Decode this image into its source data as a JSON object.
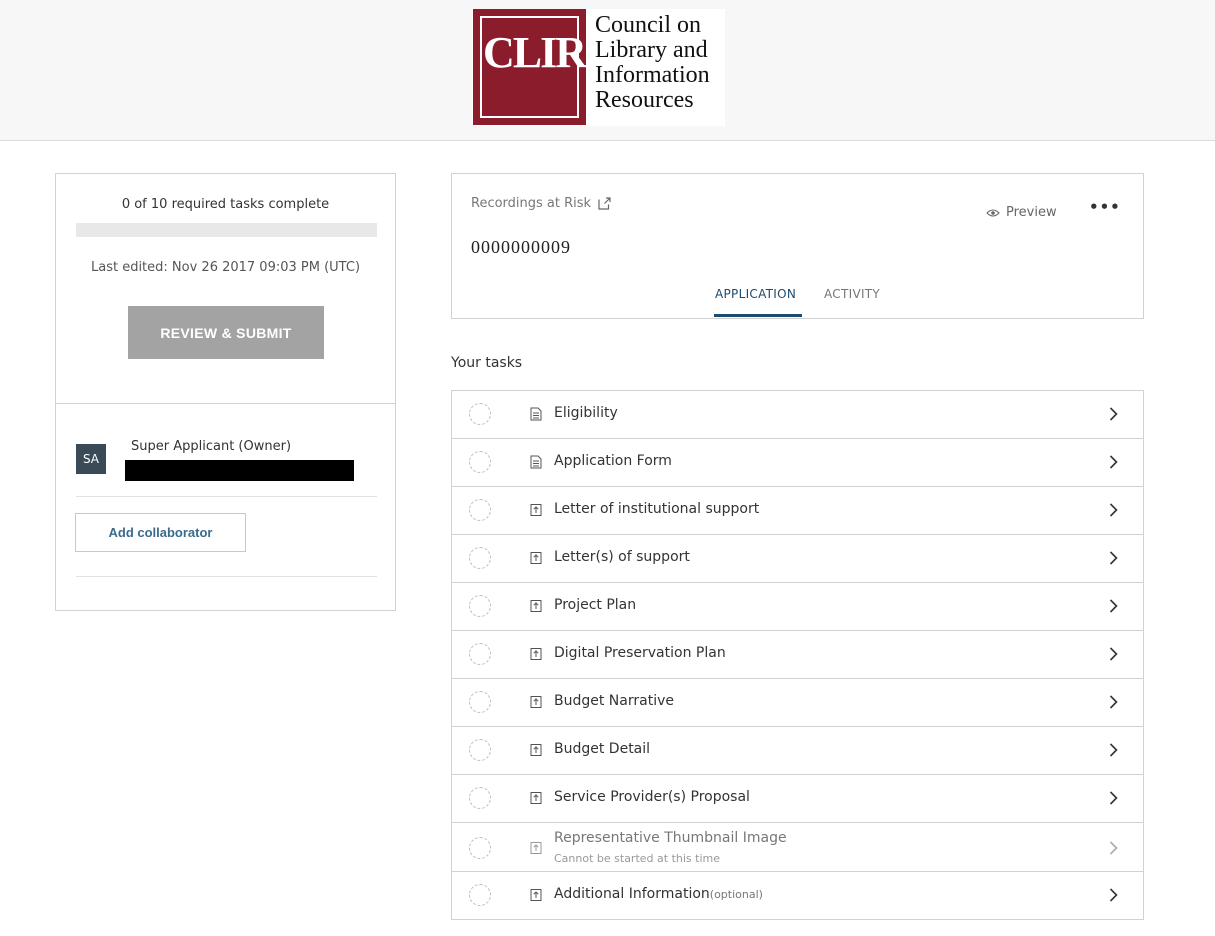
{
  "header": {
    "logo": {
      "letters": "CLIR",
      "lines": [
        "Council on",
        "Library and",
        "Information",
        "Resources"
      ],
      "brand_color": "#8b1c2c"
    }
  },
  "status": {
    "tasks_complete": "0 of 10 required tasks complete",
    "progress_fraction": 0,
    "last_edited": "Last edited: Nov 26 2017 09:03 PM (UTC)",
    "review_button": "REVIEW & SUBMIT",
    "collaborator": {
      "initials": "SA",
      "name": "Super Applicant (Owner)"
    },
    "add_collaborator": "Add collaborator"
  },
  "application": {
    "program": "Recordings at Risk",
    "program_icon": "external-link-icon",
    "id": "0000000009",
    "preview": "Preview",
    "preview_icon": "eye-icon",
    "more": "•••",
    "tabs": [
      {
        "label": "APPLICATION",
        "active": true
      },
      {
        "label": "ACTIVITY",
        "active": false
      }
    ]
  },
  "tasks": {
    "heading": "Your tasks",
    "items": [
      {
        "name": "Eligibility",
        "icon": "form-icon"
      },
      {
        "name": "Application Form",
        "icon": "form-icon"
      },
      {
        "name": "Letter of institutional support",
        "icon": "upload-icon"
      },
      {
        "name": "Letter(s) of support",
        "icon": "upload-icon"
      },
      {
        "name": "Project Plan",
        "icon": "upload-icon"
      },
      {
        "name": "Digital Preservation Plan",
        "icon": "upload-icon"
      },
      {
        "name": "Budget Narrative",
        "icon": "upload-icon"
      },
      {
        "name": "Budget Detail",
        "icon": "upload-icon"
      },
      {
        "name": "Service Provider(s) Proposal",
        "icon": "upload-icon"
      },
      {
        "name": "Representative Thumbnail Image",
        "icon": "upload-icon",
        "subtitle": "Cannot be started at this time",
        "disabled": true
      },
      {
        "name": "Additional Information",
        "icon": "upload-icon",
        "optional": "(optional)"
      }
    ]
  }
}
